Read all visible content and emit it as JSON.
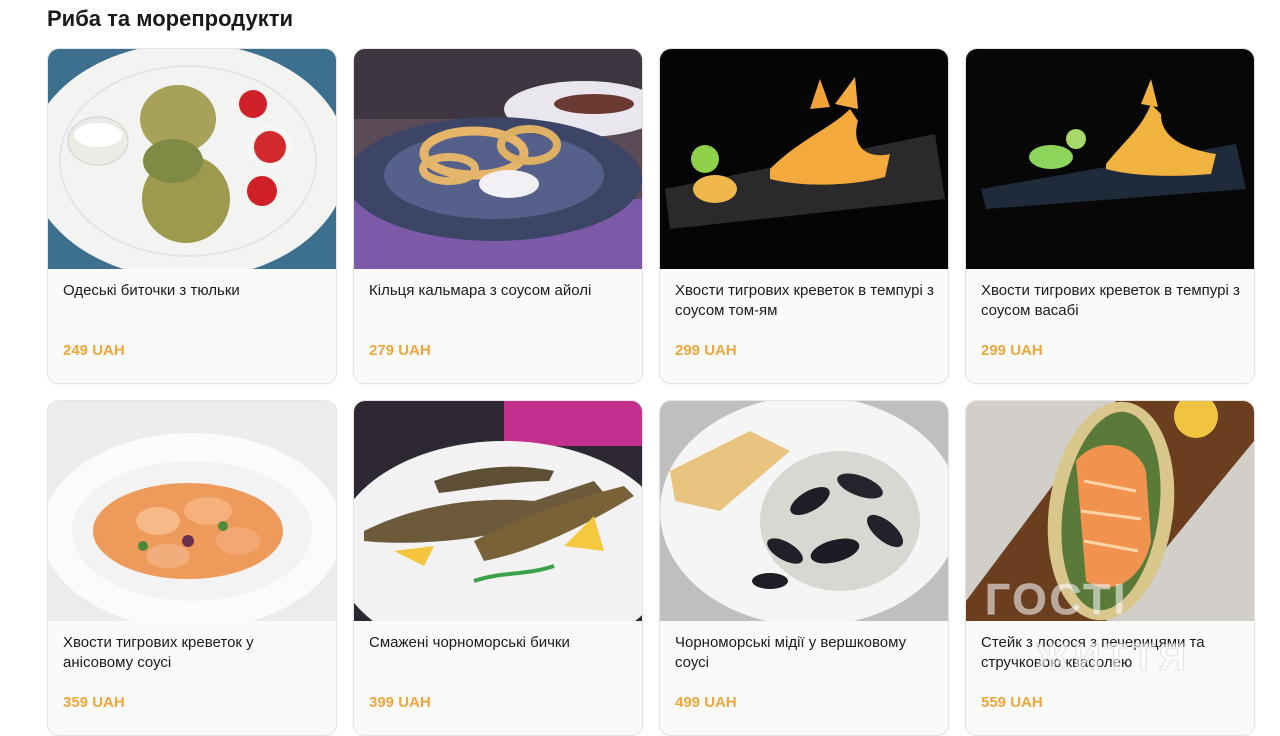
{
  "section": {
    "title": "Риба та морепродукти"
  },
  "products": [
    {
      "name": "Одеські биточки з тюльки",
      "price": "249 UAH"
    },
    {
      "name": "Кільця кальмара з соусом айолі",
      "price": "279 UAH"
    },
    {
      "name": "Хвости тигрових креветок в темпурі з соусом том-ям",
      "price": "299 UAH"
    },
    {
      "name": "Хвости тигрових креветок в темпурі з соусом васабі",
      "price": "299 UAH"
    },
    {
      "name": "Хвости тигрових креветок у анісовому соусі",
      "price": "359 UAH"
    },
    {
      "name": "Смажені чорноморські бички",
      "price": "399 UAH"
    },
    {
      "name": "Чорноморські мідії у вершковому соусі",
      "price": "499 UAH"
    },
    {
      "name": "Стейк з лосося з печерицями та стручковою квасолею",
      "price": "559 UAH"
    }
  ],
  "watermark": {
    "line1": "ГОСТІ",
    "line2": "ЖИТТЯ"
  },
  "colors": {
    "price": "#f0a63a",
    "card_bg": "#fafafa",
    "border": "#e4e4e4"
  }
}
